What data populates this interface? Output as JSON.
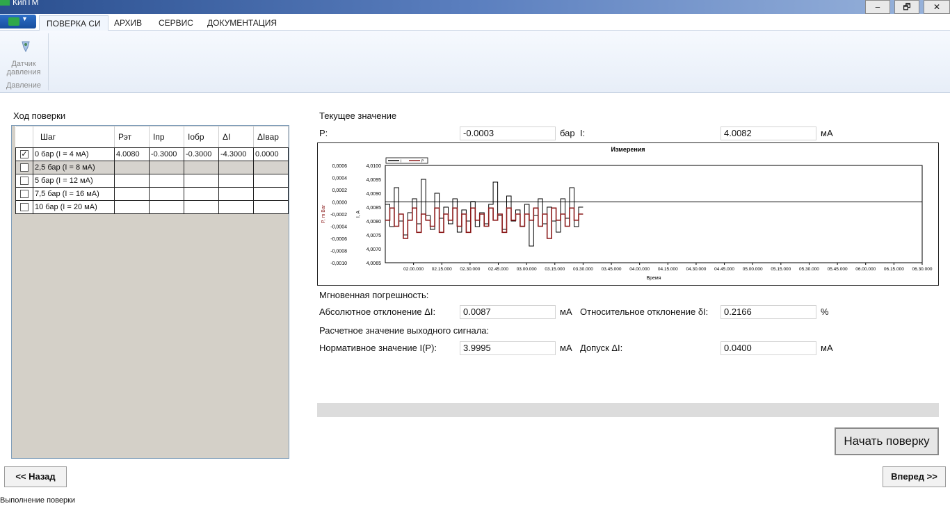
{
  "window": {
    "title": "КипТМ",
    "minimize": "‒",
    "restore": "🗗",
    "close": "✕"
  },
  "ribbon": {
    "tabs": [
      "ПОВЕРКА СИ",
      "АРХИВ",
      "СЕРВИС",
      "ДОКУМЕНТАЦИЯ"
    ],
    "active_tab": "ПОВЕРКА СИ",
    "group": {
      "button_label_line1": "Датчик",
      "button_label_line2": "давления",
      "label": "Давление"
    }
  },
  "progress_panel": {
    "title": "Ход поверки",
    "columns": [
      "Шаг",
      "Рэт",
      "Iпр",
      "Iобр",
      "ΔI",
      "ΔIвар"
    ],
    "rows": [
      {
        "checked": true,
        "step": "0 бар (I = 4 мА)",
        "pet": "4.0080",
        "ipr": "-0.3000",
        "iobr": "-0.3000",
        "di": "-4.3000",
        "divar": "0.0000"
      },
      {
        "checked": false,
        "step": "2,5 бар (I = 8 мА)",
        "pet": "",
        "ipr": "",
        "iobr": "",
        "di": "",
        "divar": ""
      },
      {
        "checked": false,
        "step": "5 бар (I = 12 мА)",
        "pet": "",
        "ipr": "",
        "iobr": "",
        "di": "",
        "divar": ""
      },
      {
        "checked": false,
        "step": "7,5 бар (I = 16 мА)",
        "pet": "",
        "ipr": "",
        "iobr": "",
        "di": "",
        "divar": ""
      },
      {
        "checked": false,
        "step": "10 бар (I = 20 мА)",
        "pet": "",
        "ipr": "",
        "iobr": "",
        "di": "",
        "divar": ""
      }
    ]
  },
  "current": {
    "title": "Текущее значение",
    "p_label": "P:",
    "p_value": "-0.0003",
    "p_unit": "бар",
    "i_label": "I:",
    "i_value": "4.0082",
    "i_unit": "мА"
  },
  "chart_data": {
    "type": "line",
    "title": "Измерения",
    "xlabel": "Время",
    "ylabel_left": "P, m Bar",
    "ylabel_right": "I, A",
    "legend": [
      "I",
      "P"
    ],
    "legend_placement": "top-left",
    "x_ticks": [
      "02.00.000",
      "02.15.000",
      "02.30.000",
      "02.45.000",
      "03.00.000",
      "03.15.000",
      "03.30.000",
      "03.45.000",
      "04.00.000",
      "04.15.000",
      "04.30.000",
      "04.45.000",
      "05.00.000",
      "05.15.000",
      "05.30.000",
      "05.45.000",
      "06.00.000",
      "06.15.000",
      "06.30.000"
    ],
    "y_left_ticks": [
      "0,0006",
      "0,0004",
      "0,0002",
      "0,0000",
      "-0,0002",
      "-0,0004",
      "-0,0006",
      "-0,0008",
      "-0,0010"
    ],
    "y_right_ticks": [
      "4,0100",
      "4,0095",
      "4,0090",
      "4,0085",
      "4,0080",
      "4,0075",
      "4,0070",
      "4,0065"
    ],
    "ylim_left": [
      -0.001,
      0.0006
    ],
    "ylim_right": [
      4.0065,
      4.01
    ],
    "xlim": [
      "01.45.000",
      "06.30.000"
    ],
    "grid": false,
    "colors": {
      "I": "#000000",
      "P": "#8b1a1a"
    },
    "series": [
      {
        "name": "I",
        "axis": "right",
        "x_range": [
          "01.45.000",
          "03.30.000"
        ],
        "values": [
          4.0086,
          4.0078,
          4.0092,
          4.008,
          4.0075,
          4.0083,
          4.0088,
          4.0079,
          4.0095,
          4.0082,
          4.0077,
          4.009,
          4.0081,
          4.0085,
          4.0079,
          4.0088,
          4.0076,
          4.0084,
          4.008,
          4.0087,
          4.0078,
          4.0083,
          4.0079,
          4.0086,
          4.0094,
          4.0082,
          4.0077,
          4.0089,
          4.008,
          4.0084,
          4.0078,
          4.0086,
          4.0071,
          4.0082,
          4.0088,
          4.0079,
          4.0085,
          4.008,
          4.0076,
          4.0088,
          4.0081,
          4.0092,
          4.0078,
          4.0085
        ]
      },
      {
        "name": "P",
        "axis": "left",
        "x_range": [
          "01.45.000",
          "03.30.000"
        ],
        "values": [
          -0.0003,
          -0.0001,
          -0.0004,
          -0.0002,
          -0.0006,
          -0.0003,
          -0.0001,
          -0.0005,
          -0.0002,
          -0.0003,
          -0.0004,
          -0.0001,
          -0.0005,
          -0.0002,
          -0.0003,
          -0.0001,
          -0.0004,
          -0.0002,
          -0.0005,
          -0.0001,
          -0.0003,
          -0.0002,
          -0.0004,
          -0.0001,
          -0.0003,
          -0.0002,
          -0.0005,
          -0.0001,
          -0.0003,
          -0.0002,
          -0.0004,
          -0.0002,
          -0.0003,
          -0.0001,
          -0.0004,
          -0.0002,
          -0.0006,
          -0.0001,
          -0.0003,
          -0.0002,
          -0.0004,
          -0.0001,
          -0.0003,
          -0.0002
        ]
      }
    ]
  },
  "instant_error": {
    "title": "Мгновенная погрешность:",
    "abs_label": "Абсолютное отклонение ΔI:",
    "abs_value": "0.0087",
    "abs_unit": "мА",
    "rel_label": "Относительное отклонение δI:",
    "rel_value": "0.2166",
    "rel_unit": "%"
  },
  "calculated": {
    "title": "Расчетное значение выходного сигнала:",
    "norm_label": "Нормативное значение I(P):",
    "norm_value": "3.9995",
    "norm_unit": "мА",
    "tol_label": "Допуск ΔI:",
    "tol_value": "0.0400",
    "tol_unit": "мА"
  },
  "progress": {
    "value": 0
  },
  "buttons": {
    "start": "Начать поверку",
    "back": "<< Назад",
    "next": "Вперед >>"
  },
  "status": {
    "text": "Выполнение поверки"
  }
}
